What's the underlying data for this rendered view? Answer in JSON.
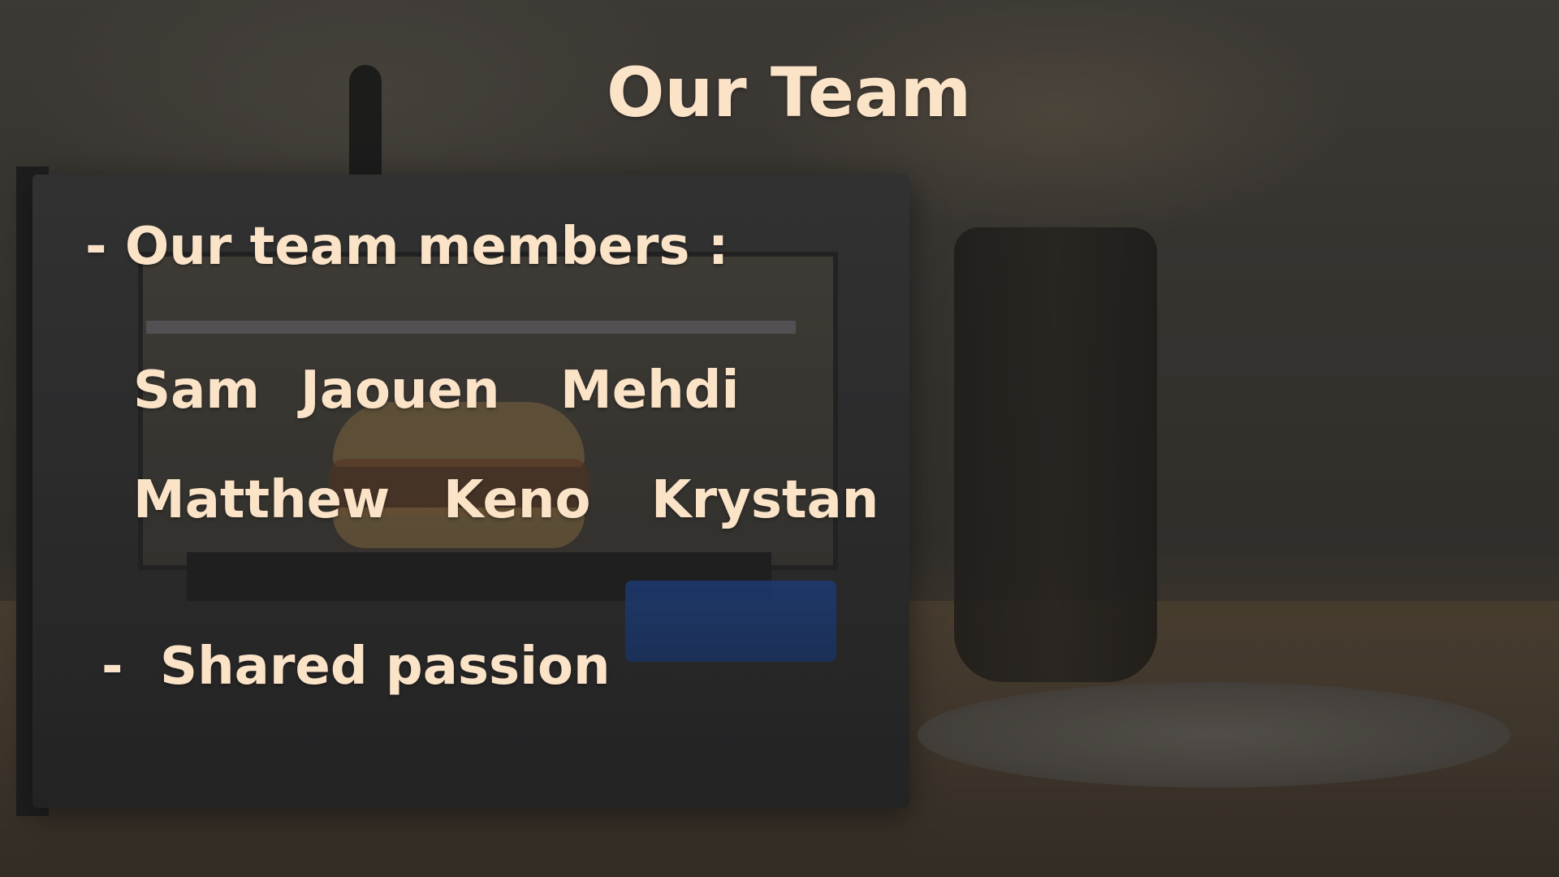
{
  "slide": {
    "title": "Our Team",
    "members_bullet": "- Our team members :",
    "members": {
      "row1": [
        "Sam",
        "Jaouen",
        "Mehdi"
      ],
      "row2": [
        "Matthew",
        "Keno",
        "Krystan"
      ]
    },
    "passion_bullet_marker": "-",
    "passion_bullet_text": "Shared passion"
  },
  "colors": {
    "text": "#fbe3c8",
    "background": "#3e3a36"
  }
}
